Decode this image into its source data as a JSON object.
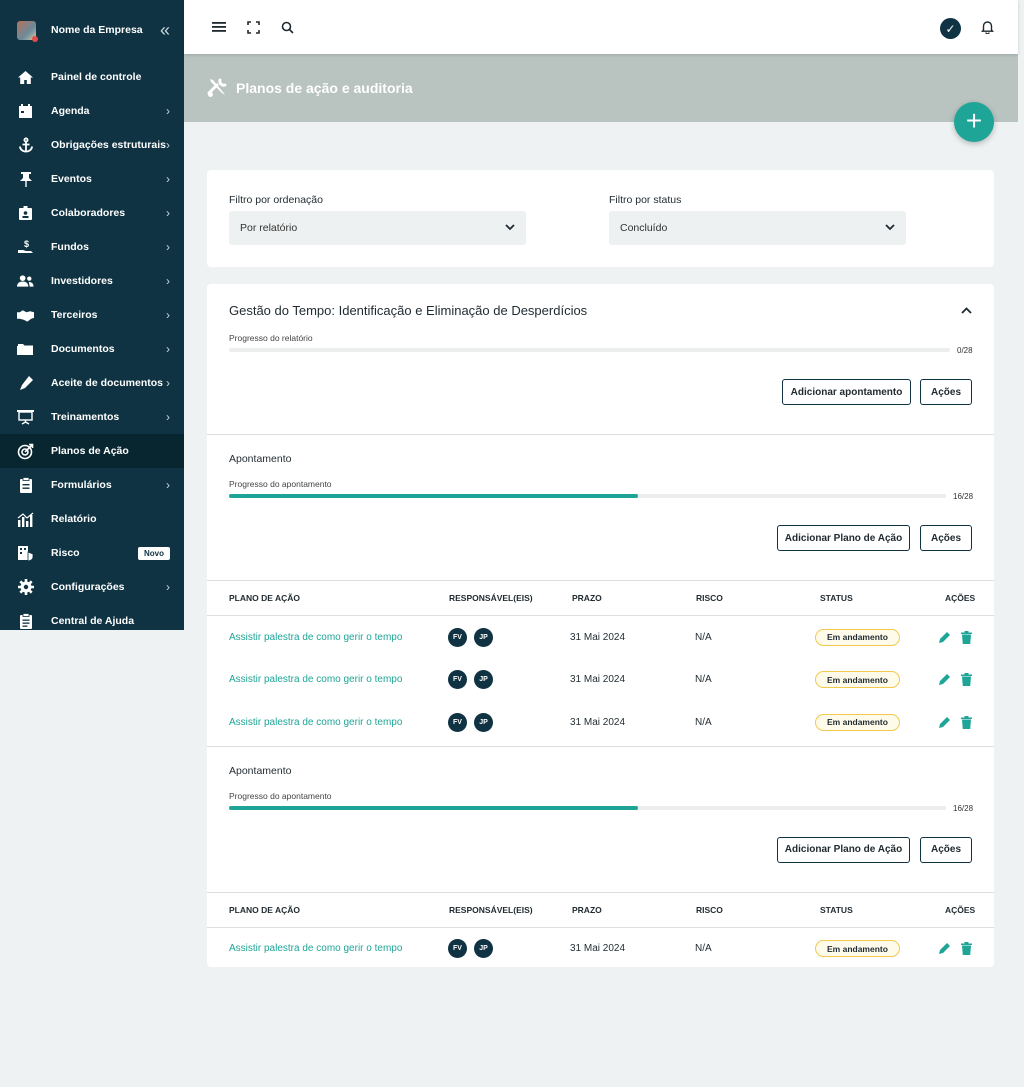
{
  "sidebar": {
    "company": "Nome da Empresa",
    "items": [
      {
        "label": "Painel de controle",
        "icon": "home-icon",
        "chevron": false
      },
      {
        "label": "Agenda",
        "icon": "calendar-icon",
        "chevron": true
      },
      {
        "label": "Obrigações estruturais",
        "icon": "anchor-icon",
        "chevron": true
      },
      {
        "label": "Eventos",
        "icon": "pin-icon",
        "chevron": true
      },
      {
        "label": "Colaboradores",
        "icon": "badge-icon",
        "chevron": true
      },
      {
        "label": "Fundos",
        "icon": "money-hand-icon",
        "chevron": true
      },
      {
        "label": "Investidores",
        "icon": "users-icon",
        "chevron": true
      },
      {
        "label": "Terceiros",
        "icon": "handshake-icon",
        "chevron": true
      },
      {
        "label": "Documentos",
        "icon": "folder-icon",
        "chevron": true
      },
      {
        "label": "Aceite de documentos",
        "icon": "pen-icon",
        "chevron": true
      },
      {
        "label": "Treinamentos",
        "icon": "presentation-icon",
        "chevron": true
      },
      {
        "label": "Planos de Ação",
        "icon": "target-icon",
        "chevron": false,
        "active": true
      },
      {
        "label": "Formulários",
        "icon": "clipboard-icon",
        "chevron": true
      },
      {
        "label": "Relatório",
        "icon": "bar-chart-icon",
        "chevron": false
      },
      {
        "label": "Risco",
        "icon": "risk-icon",
        "chevron": false,
        "badge": "Novo"
      },
      {
        "label": "Configurações",
        "icon": "gear-icon",
        "chevron": true
      },
      {
        "label": "Central de Ajuda",
        "icon": "help-clipboard-icon",
        "chevron": false
      }
    ]
  },
  "header": {
    "title": "Planos de ação e auditoria"
  },
  "filters": {
    "order_label": "Filtro por ordenação",
    "order_value": "Por relatório",
    "status_label": "Filtro por status",
    "status_value": "Concluído"
  },
  "report": {
    "title": "Gestão do Tempo: Identificação e Eliminação de Desperdícios",
    "progress_label": "Progresso do relatório",
    "progress_count": "0/28",
    "progress_fraction": 0,
    "add_button": "Adicionar apontamento",
    "actions_button": "Ações"
  },
  "table_headers": {
    "plan": "PLANO DE AÇÃO",
    "responsible": "RESPONSÁVEL(EIS)",
    "deadline": "PRAZO",
    "risk": "RISCO",
    "status": "STATUS",
    "actions": "AÇÕES"
  },
  "findings": [
    {
      "title": "Apontamento",
      "progress_label": "Progresso do apontamento",
      "progress_count": "16/28",
      "progress_fraction": 0.571,
      "add_button": "Adicionar Plano de Ação",
      "actions_button": "Ações",
      "rows": [
        {
          "plan": "Assistir palestra de como gerir o tempo",
          "people": [
            "FV",
            "JP"
          ],
          "deadline": "31 Mai 2024",
          "risk": "N/A",
          "status": "Em andamento"
        },
        {
          "plan": "Assistir palestra de como gerir o tempo",
          "people": [
            "FV",
            "JP"
          ],
          "deadline": "31 Mai 2024",
          "risk": "N/A",
          "status": "Em andamento"
        },
        {
          "plan": "Assistir palestra de como gerir o tempo",
          "people": [
            "FV",
            "JP"
          ],
          "deadline": "31 Mai 2024",
          "risk": "N/A",
          "status": "Em andamento"
        }
      ]
    },
    {
      "title": "Apontamento",
      "progress_label": "Progresso do apontamento",
      "progress_count": "16/28",
      "progress_fraction": 0.571,
      "add_button": "Adicionar Plano de Ação",
      "actions_button": "Ações",
      "rows": [
        {
          "plan": "Assistir palestra de como gerir o tempo",
          "people": [
            "FV",
            "JP"
          ],
          "deadline": "31 Mai 2024",
          "risk": "N/A",
          "status": "Em andamento"
        }
      ]
    }
  ],
  "colors": {
    "sidebar": "#0f3342",
    "accent": "#1ea597",
    "header_band": "#b9c3c0",
    "status_border": "#f2c94c"
  }
}
